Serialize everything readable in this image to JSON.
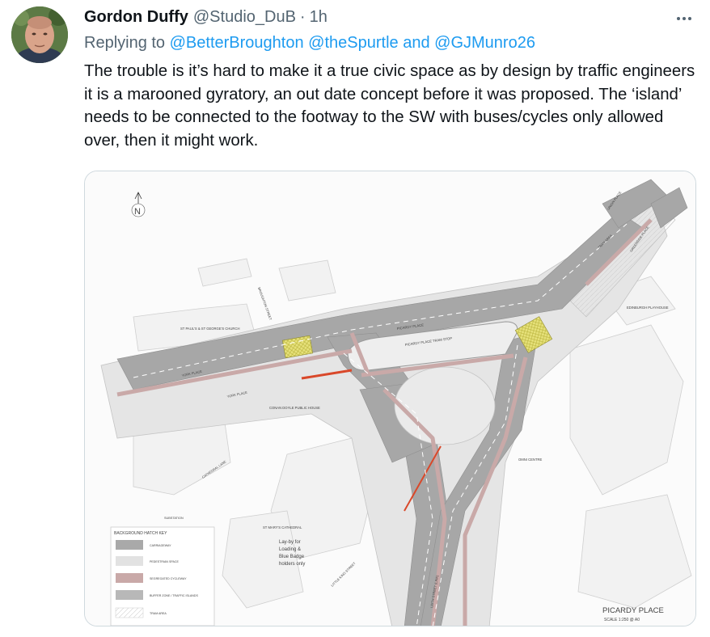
{
  "tweet": {
    "author_name": "Gordon Duffy",
    "author_handle": "@Studio_DuB",
    "separator": "·",
    "timestamp": "1h",
    "reply_prefix": "Replying to",
    "reply_to": [
      "@BetterBroughton",
      "@theSpurtle",
      "@GJMunro26"
    ],
    "reply_joiner": "and",
    "text": "The trouble is it’s hard to make it a true civic space as by design by traffic engineers it is a marooned gyratory, an out date concept before it was proposed. The ‘island’ needs to be connected to the footway to the SW with buses/cycles only allowed over, then it might work."
  },
  "icons": {
    "more": "more-horizontal-icon",
    "north_arrow": "north-arrow-icon"
  },
  "colors": {
    "link": "#1d9bf0",
    "muted": "#536471",
    "text": "#0f1419",
    "border": "#cfd9de"
  },
  "plan": {
    "north": "N",
    "labels": {
      "union_place": "UNION PLACE",
      "tram_area": "TRAM AREA",
      "greenside_place": "GREENSIDE PLACE",
      "edinburgh_playhouse": "EDINBURGH PLAYHOUSE",
      "broughton_street": "BROUGHTON STREET",
      "st_pauls": "ST PAUL'S & ST GEORGE'S CHURCH",
      "picardy_place": "PICARDY PLACE",
      "tram_stop": "PICARDY PLACE TRAM STOP",
      "york_place_1": "YORK PLACE",
      "york_place_2": "YORK PLACE",
      "conan_doyle": "CONAN DOYLE PUBLIC HOUSE",
      "cathedral_lane": "CATHEDRAL LANE",
      "omni_centre": "OMNI CENTRE",
      "substation": "SUBSTATION",
      "st_marys": "ST MARY'S CATHEDRAL",
      "little_king_street": "LITTLE KING STREET",
      "leith_street": "LEITH STREET (LINK)",
      "layby": [
        "Lay-by for",
        "Loading &",
        "Blue Badge",
        "holders only"
      ],
      "title": "PICARDY PLACE",
      "scale": "SCALE 1:250 @ A0"
    },
    "key": {
      "heading": "BACKGROUND HATCH KEY",
      "items": [
        {
          "label": "CARRIAGEWAY",
          "color": "#a9a9a9"
        },
        {
          "label": "PEDESTRIAN SPACE",
          "color": "#e2e2e2"
        },
        {
          "label": "SEGREGATED CYCLEWAY",
          "color": "#c9a9a8"
        },
        {
          "label": "BUFFER ZONE / TRAFFIC ISLANDS",
          "color": "#b8b8b8"
        },
        {
          "label": "TRAM AREA",
          "color": "#f4f4f4"
        }
      ]
    }
  }
}
